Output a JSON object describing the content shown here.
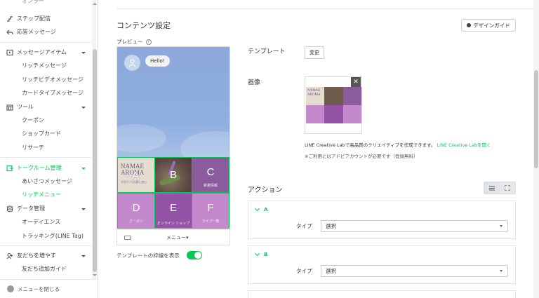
{
  "sidebar": {
    "top_partial": "オンラー",
    "step_delivery": "ステップ配信",
    "auto_reply": "応答メッセージ",
    "message_items": {
      "label": "メッセージアイテム",
      "children": [
        "リッチメッセージ",
        "リッチビデオメッセージ",
        "カードタイプメッセージ"
      ]
    },
    "tools": {
      "label": "ツール",
      "children": [
        "クーポン",
        "ショップカード",
        "リサーチ"
      ]
    },
    "chat_room": {
      "label": "トークルーム管理",
      "children": [
        "あいさつメッセージ",
        "リッチメニュー"
      ],
      "active_child": "リッチメニュー"
    },
    "data": {
      "label": "データ管理",
      "children": [
        "オーディエンス",
        "トラッキング(LINE Tag)"
      ]
    },
    "friends": {
      "label": "友だちを増やす",
      "children": [
        "友だち追加ガイド"
      ]
    },
    "footer": "メニューを閉じる"
  },
  "content": {
    "title": "コンテンツ設定",
    "design_guide": "デザインガイド",
    "preview_label": "プレビュー",
    "chat_bubble": "Hello!",
    "menu_bar": "メニュー▾",
    "show_border_label": "テンプレートの枠線を表示",
    "show_border_on": true
  },
  "rich_menu_cells": [
    {
      "letter": "A",
      "caption": "",
      "bg": "#e3dccf",
      "logo_line1": "NAMAE",
      "logo_line2": "AROMA",
      "logo_sub": "お肌ケア/店舗に絡む"
    },
    {
      "letter": "B",
      "caption": "",
      "bg": "#6f5a4e"
    },
    {
      "letter": "C",
      "caption": "新着情報",
      "bg": "#8a5c9e"
    },
    {
      "letter": "D",
      "caption": "クーポン",
      "bg": "#c389cc"
    },
    {
      "letter": "E",
      "caption": "オンライン ショップ",
      "bg": "#9553a8"
    },
    {
      "letter": "F",
      "caption": "ライブ一覧",
      "bg": "#c389cc"
    }
  ],
  "template": {
    "label": "テンプレート",
    "change_button": "変更"
  },
  "image": {
    "label": "画像",
    "close": "✕",
    "note_prefix": "LINE Creative Labで高品質のクリエイティブを作成できます。",
    "note_link": "LINE Creative Labを開く",
    "note_account": "※ご利用にはアドビアカウントが必要です（登録無料）"
  },
  "actions": {
    "title": "アクション",
    "items": [
      {
        "name": "A",
        "type_label": "タイプ",
        "type_value": "選択"
      },
      {
        "name": "B",
        "type_label": "タイプ",
        "type_value": "選択"
      }
    ]
  },
  "colors": {
    "accent": "#06c755",
    "chat_bg": "#8da9dc",
    "purple": "#9553a8"
  }
}
